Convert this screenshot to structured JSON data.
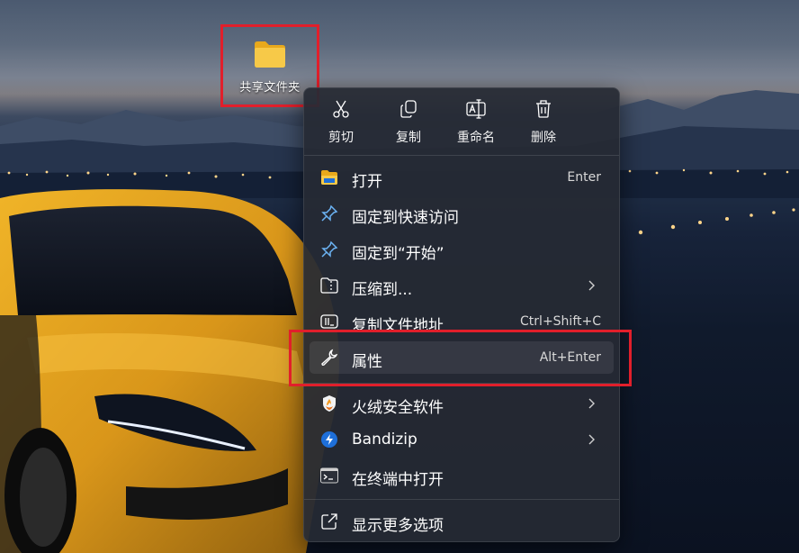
{
  "colors": {
    "highlight_box": "#e11f2b",
    "menu_bg": "#262a34",
    "accent_blue": "#1e6fd9",
    "folder_yellow": "#f7c948"
  },
  "desktop": {
    "folder": {
      "label": "共享文件夹",
      "icon": "folder-icon"
    }
  },
  "context_menu": {
    "quick_actions": [
      {
        "label": "剪切",
        "icon": "scissors-icon"
      },
      {
        "label": "复制",
        "icon": "copy-icon"
      },
      {
        "label": "重命名",
        "icon": "rename-icon"
      },
      {
        "label": "删除",
        "icon": "trash-icon"
      }
    ],
    "items": {
      "open": {
        "label": "打开",
        "shortcut": "Enter",
        "icon": "folder-open-icon"
      },
      "pin_quick": {
        "label": "固定到快速访问",
        "icon": "pin-icon"
      },
      "pin_start": {
        "label": "固定到“开始”",
        "icon": "pin-icon"
      },
      "compress": {
        "label": "压缩到...",
        "icon": "zip-icon",
        "has_submenu": true
      },
      "copy_path": {
        "label": "复制文件地址",
        "shortcut": "Ctrl+Shift+C",
        "icon": "copy-path-icon"
      },
      "properties": {
        "label": "属性",
        "shortcut": "Alt+Enter",
        "icon": "wrench-icon"
      },
      "huorong": {
        "label": "火绒安全软件",
        "icon": "huorong-shield-icon",
        "has_submenu": true
      },
      "bandizip": {
        "label": "Bandizip",
        "icon": "bandizip-icon",
        "has_submenu": true
      },
      "terminal": {
        "label": "在终端中打开",
        "icon": "terminal-icon"
      },
      "more_options": {
        "label": "显示更多选项",
        "icon": "external-open-icon"
      }
    }
  }
}
